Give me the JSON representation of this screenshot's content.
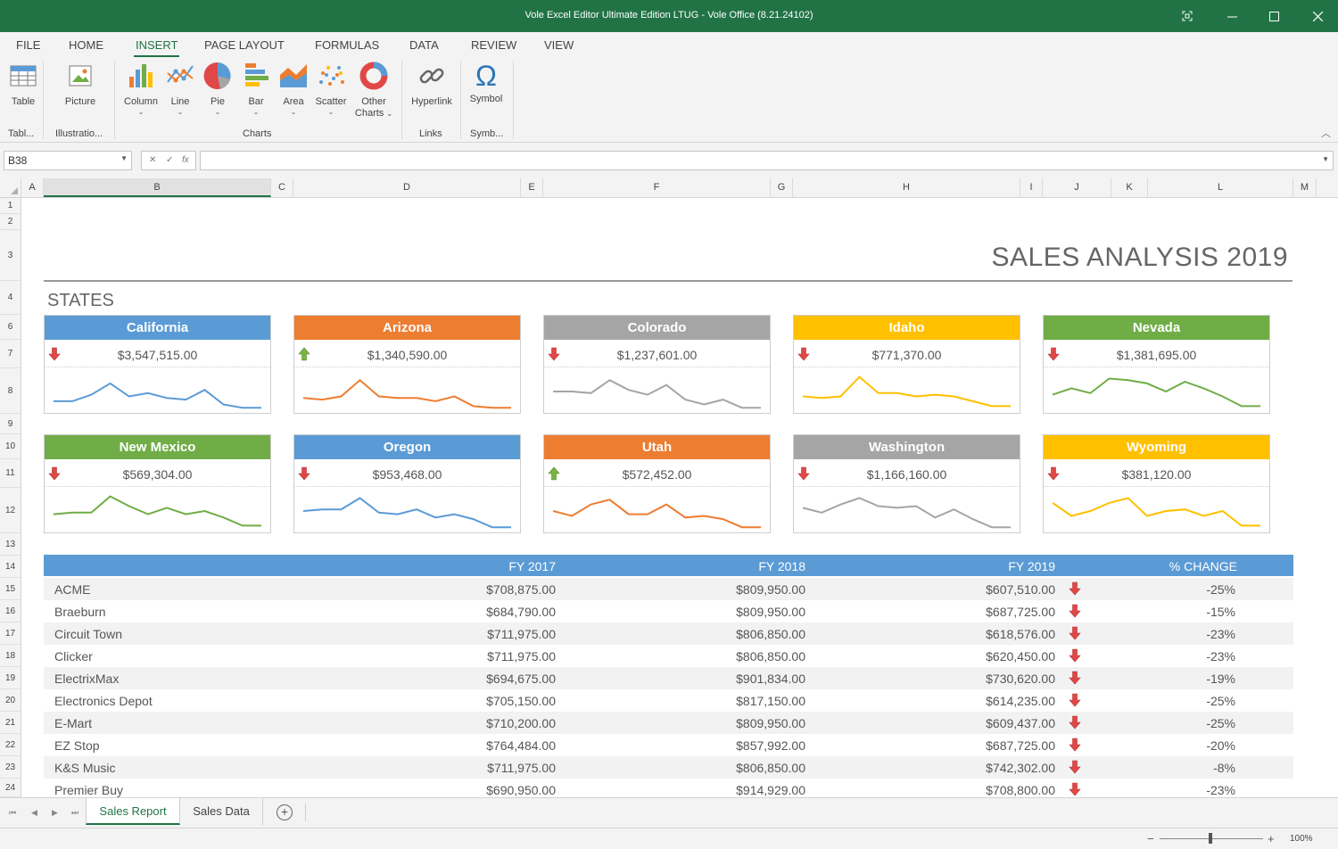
{
  "window": {
    "title": "Vole Excel Editor Ultimate Edition LTUG - Vole Office (8.21.24102)"
  },
  "menu": {
    "tabs": [
      "FILE",
      "HOME",
      "INSERT",
      "PAGE LAYOUT",
      "FORMULAS",
      "DATA",
      "REVIEW",
      "VIEW"
    ],
    "active": "INSERT"
  },
  "ribbon": {
    "table": {
      "label": "Table",
      "group": "Tabl..."
    },
    "illustrations": {
      "picture": "Picture",
      "group": "Illustratio..."
    },
    "charts": {
      "column": "Column",
      "line": "Line",
      "pie": "Pie",
      "bar": "Bar",
      "area": "Area",
      "scatter": "Scatter",
      "other1": "Other",
      "other2": "Charts",
      "group": "Charts"
    },
    "links": {
      "hyperlink": "Hyperlink",
      "group": "Links"
    },
    "symbols": {
      "symbol": "Symbol",
      "group": "Symb..."
    }
  },
  "formula_bar": {
    "name_box": "B38",
    "formula": ""
  },
  "columns": [
    "A",
    "B",
    "C",
    "D",
    "E",
    "F",
    "G",
    "H",
    "I",
    "J",
    "K",
    "L",
    "M"
  ],
  "rows": [
    "1",
    "2",
    "3",
    "4",
    "6",
    "7",
    "8",
    "9",
    "10",
    "11",
    "12",
    "13",
    "14",
    "15",
    "16",
    "17",
    "18",
    "19",
    "20",
    "21",
    "22",
    "23",
    "24"
  ],
  "report": {
    "title": "SALES ANALYSIS 2019",
    "section": "STATES"
  },
  "colors": {
    "blue": "#5b9bd5",
    "orange": "#ed7d31",
    "gray": "#a5a5a5",
    "yellow": "#ffc000",
    "green": "#70ad47",
    "down": "#e04848",
    "up": "#7cb342",
    "accent": "#217346"
  },
  "states": [
    {
      "name": "California",
      "value": "$3,547,515.00",
      "trend": "down",
      "color": "blue",
      "spark": [
        5,
        5,
        9,
        16,
        8,
        10,
        7,
        6,
        12,
        3,
        1,
        1
      ]
    },
    {
      "name": "Arizona",
      "value": "$1,340,590.00",
      "trend": "up",
      "color": "orange",
      "spark": [
        7,
        6,
        8,
        18,
        8,
        7,
        7,
        5,
        8,
        2,
        1,
        1
      ]
    },
    {
      "name": "Colorado",
      "value": "$1,237,601.00",
      "trend": "down",
      "color": "gray",
      "spark": [
        11,
        11,
        10,
        18,
        12,
        9,
        15,
        6,
        3,
        6,
        1,
        1
      ]
    },
    {
      "name": "Idaho",
      "value": "$771,370.00",
      "trend": "down",
      "color": "yellow",
      "spark": [
        8,
        7,
        8,
        20,
        10,
        10,
        8,
        9,
        8,
        5,
        2,
        2
      ]
    },
    {
      "name": "Nevada",
      "value": "$1,381,695.00",
      "trend": "down",
      "color": "green",
      "spark": [
        9,
        13,
        10,
        19,
        18,
        16,
        11,
        17,
        13,
        8,
        2,
        2
      ]
    },
    {
      "name": "New Mexico",
      "value": "$569,304.00",
      "trend": "down",
      "color": "green",
      "spark": [
        9,
        10,
        10,
        20,
        14,
        9,
        13,
        9,
        11,
        7,
        2,
        2
      ]
    },
    {
      "name": "Oregon",
      "value": "$953,468.00",
      "trend": "down",
      "color": "blue",
      "spark": [
        11,
        12,
        12,
        19,
        10,
        9,
        12,
        7,
        9,
        6,
        1,
        1
      ]
    },
    {
      "name": "Utah",
      "value": "$572,452.00",
      "trend": "up",
      "color": "orange",
      "spark": [
        11,
        8,
        15,
        18,
        9,
        9,
        15,
        7,
        8,
        6,
        1,
        1
      ]
    },
    {
      "name": "Washington",
      "value": "$1,166,160.00",
      "trend": "down",
      "color": "gray",
      "spark": [
        13,
        10,
        15,
        19,
        14,
        13,
        14,
        7,
        12,
        6,
        1,
        1
      ]
    },
    {
      "name": "Wyoming",
      "value": "$381,120.00",
      "trend": "down",
      "color": "yellow",
      "spark": [
        16,
        8,
        11,
        16,
        19,
        8,
        11,
        12,
        8,
        11,
        2,
        2
      ]
    }
  ],
  "table": {
    "headers": [
      "FY 2017",
      "FY 2018",
      "FY 2019",
      "% CHANGE"
    ],
    "rows": [
      {
        "name": "ACME",
        "fy2017": "$708,875.00",
        "fy2018": "$809,950.00",
        "fy2019": "$607,510.00",
        "trend": "down",
        "change": "-25%"
      },
      {
        "name": "Braeburn",
        "fy2017": "$684,790.00",
        "fy2018": "$809,950.00",
        "fy2019": "$687,725.00",
        "trend": "down",
        "change": "-15%"
      },
      {
        "name": "Circuit Town",
        "fy2017": "$711,975.00",
        "fy2018": "$806,850.00",
        "fy2019": "$618,576.00",
        "trend": "down",
        "change": "-23%"
      },
      {
        "name": "Clicker",
        "fy2017": "$711,975.00",
        "fy2018": "$806,850.00",
        "fy2019": "$620,450.00",
        "trend": "down",
        "change": "-23%"
      },
      {
        "name": "ElectrixMax",
        "fy2017": "$694,675.00",
        "fy2018": "$901,834.00",
        "fy2019": "$730,620.00",
        "trend": "down",
        "change": "-19%"
      },
      {
        "name": "Electronics Depot",
        "fy2017": "$705,150.00",
        "fy2018": "$817,150.00",
        "fy2019": "$614,235.00",
        "trend": "down",
        "change": "-25%"
      },
      {
        "name": "E-Mart",
        "fy2017": "$710,200.00",
        "fy2018": "$809,950.00",
        "fy2019": "$609,437.00",
        "trend": "down",
        "change": "-25%"
      },
      {
        "name": "EZ Stop",
        "fy2017": "$764,484.00",
        "fy2018": "$857,992.00",
        "fy2019": "$687,725.00",
        "trend": "down",
        "change": "-20%"
      },
      {
        "name": "K&S Music",
        "fy2017": "$711,975.00",
        "fy2018": "$806,850.00",
        "fy2019": "$742,302.00",
        "trend": "down",
        "change": "-8%"
      },
      {
        "name": "Premier Buy",
        "fy2017": "$690,950.00",
        "fy2018": "$914,929.00",
        "fy2019": "$708,800.00",
        "trend": "down",
        "change": "-23%"
      }
    ]
  },
  "sheets": {
    "tabs": [
      "Sales Report",
      "Sales Data"
    ],
    "active": "Sales Report",
    "add": "+"
  },
  "status": {
    "zoom": "100%",
    "zoom_fraction": 0.5,
    "minus": "−",
    "plus": "+"
  }
}
